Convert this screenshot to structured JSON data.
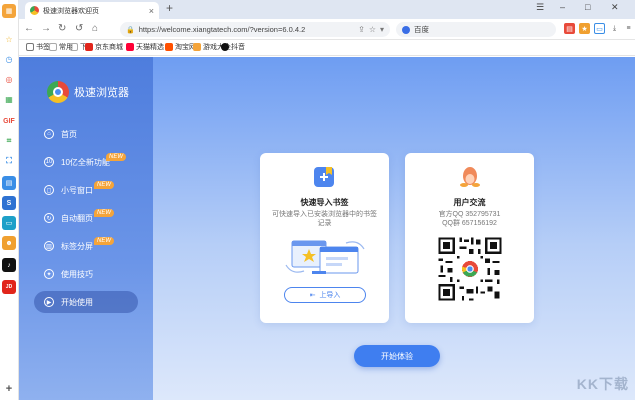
{
  "tab": {
    "title": "极速浏览器欢迎页",
    "close": "×",
    "new": "+"
  },
  "window": {
    "menu": "☰",
    "minimize": "–",
    "maximize": "□",
    "close": "✕"
  },
  "nav": {
    "back": "←",
    "forward": "→",
    "refresh": "↻",
    "undo": "↺",
    "home": "⌂",
    "url": "https://welcome.xiangtatech.com/?version=6.0.4.2",
    "search_value": "百度"
  },
  "bookmarks": [
    {
      "label": "书签",
      "color": "#777777"
    },
    {
      "label": "常用",
      "color": "#ffffff"
    },
    {
      "label": "下",
      "color": "#ffffff"
    },
    {
      "label": "京东商城",
      "color": "#e1251b"
    },
    {
      "label": "天猫精选",
      "color": "#ff0036"
    },
    {
      "label": "淘宝网",
      "color": "#ff5000"
    },
    {
      "label": "游戏大全",
      "color": "#f4a43a"
    },
    {
      "label": "抖音",
      "color": "#111111"
    }
  ],
  "brand": {
    "name": "极速浏览器"
  },
  "menu": [
    {
      "label": "首页",
      "icon": "⌂",
      "new": false
    },
    {
      "label": "10亿全新功能",
      "icon": "10",
      "new": true
    },
    {
      "label": "小号窗口",
      "icon": "◻",
      "new": true
    },
    {
      "label": "自动翻页",
      "icon": "↻",
      "new": true
    },
    {
      "label": "标签分屏",
      "icon": "▥",
      "new": true
    },
    {
      "label": "使用技巧",
      "icon": "✦",
      "new": false
    },
    {
      "label": "开始使用",
      "icon": "▶",
      "new": false
    }
  ],
  "new_badge": "NEW",
  "card_import": {
    "title": "快速导入书签",
    "desc": "可快速导入已安装浏览器中的书签记录",
    "button": "上导入"
  },
  "card_contact": {
    "title": "用户交流",
    "desc1": "官方QQ 352795731",
    "desc2": "QQ群 657156192"
  },
  "start_button": "开始体验",
  "watermark": "KK下载",
  "colors": {
    "accent": "#3f7ef0",
    "sidebar": "#4e7ddd",
    "badge": "#f4a43a"
  }
}
